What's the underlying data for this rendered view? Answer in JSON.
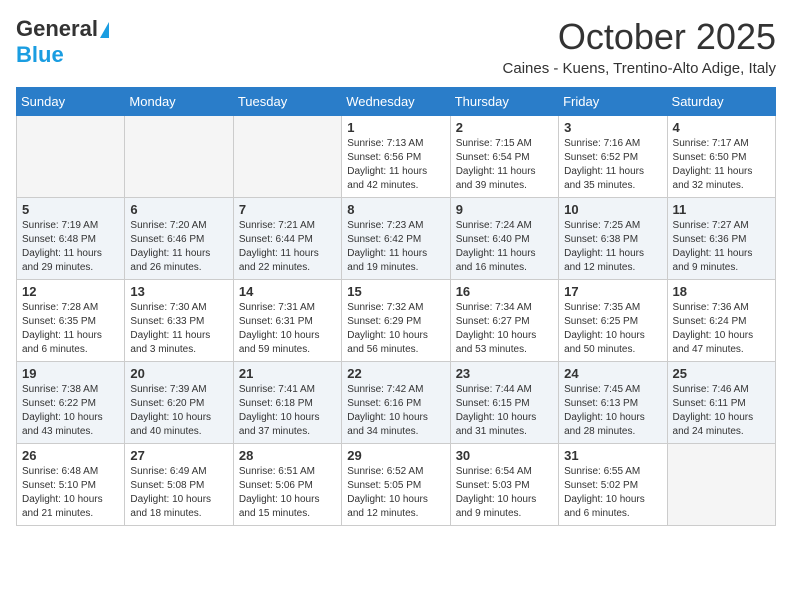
{
  "header": {
    "logo_general": "General",
    "logo_blue": "Blue",
    "month_title": "October 2025",
    "subtitle": "Caines - Kuens, Trentino-Alto Adige, Italy"
  },
  "weekdays": [
    "Sunday",
    "Monday",
    "Tuesday",
    "Wednesday",
    "Thursday",
    "Friday",
    "Saturday"
  ],
  "weeks": [
    [
      {
        "day": "",
        "sunrise": "",
        "sunset": "",
        "daylight": ""
      },
      {
        "day": "",
        "sunrise": "",
        "sunset": "",
        "daylight": ""
      },
      {
        "day": "",
        "sunrise": "",
        "sunset": "",
        "daylight": ""
      },
      {
        "day": "1",
        "sunrise": "Sunrise: 7:13 AM",
        "sunset": "Sunset: 6:56 PM",
        "daylight": "Daylight: 11 hours and 42 minutes."
      },
      {
        "day": "2",
        "sunrise": "Sunrise: 7:15 AM",
        "sunset": "Sunset: 6:54 PM",
        "daylight": "Daylight: 11 hours and 39 minutes."
      },
      {
        "day": "3",
        "sunrise": "Sunrise: 7:16 AM",
        "sunset": "Sunset: 6:52 PM",
        "daylight": "Daylight: 11 hours and 35 minutes."
      },
      {
        "day": "4",
        "sunrise": "Sunrise: 7:17 AM",
        "sunset": "Sunset: 6:50 PM",
        "daylight": "Daylight: 11 hours and 32 minutes."
      }
    ],
    [
      {
        "day": "5",
        "sunrise": "Sunrise: 7:19 AM",
        "sunset": "Sunset: 6:48 PM",
        "daylight": "Daylight: 11 hours and 29 minutes."
      },
      {
        "day": "6",
        "sunrise": "Sunrise: 7:20 AM",
        "sunset": "Sunset: 6:46 PM",
        "daylight": "Daylight: 11 hours and 26 minutes."
      },
      {
        "day": "7",
        "sunrise": "Sunrise: 7:21 AM",
        "sunset": "Sunset: 6:44 PM",
        "daylight": "Daylight: 11 hours and 22 minutes."
      },
      {
        "day": "8",
        "sunrise": "Sunrise: 7:23 AM",
        "sunset": "Sunset: 6:42 PM",
        "daylight": "Daylight: 11 hours and 19 minutes."
      },
      {
        "day": "9",
        "sunrise": "Sunrise: 7:24 AM",
        "sunset": "Sunset: 6:40 PM",
        "daylight": "Daylight: 11 hours and 16 minutes."
      },
      {
        "day": "10",
        "sunrise": "Sunrise: 7:25 AM",
        "sunset": "Sunset: 6:38 PM",
        "daylight": "Daylight: 11 hours and 12 minutes."
      },
      {
        "day": "11",
        "sunrise": "Sunrise: 7:27 AM",
        "sunset": "Sunset: 6:36 PM",
        "daylight": "Daylight: 11 hours and 9 minutes."
      }
    ],
    [
      {
        "day": "12",
        "sunrise": "Sunrise: 7:28 AM",
        "sunset": "Sunset: 6:35 PM",
        "daylight": "Daylight: 11 hours and 6 minutes."
      },
      {
        "day": "13",
        "sunrise": "Sunrise: 7:30 AM",
        "sunset": "Sunset: 6:33 PM",
        "daylight": "Daylight: 11 hours and 3 minutes."
      },
      {
        "day": "14",
        "sunrise": "Sunrise: 7:31 AM",
        "sunset": "Sunset: 6:31 PM",
        "daylight": "Daylight: 10 hours and 59 minutes."
      },
      {
        "day": "15",
        "sunrise": "Sunrise: 7:32 AM",
        "sunset": "Sunset: 6:29 PM",
        "daylight": "Daylight: 10 hours and 56 minutes."
      },
      {
        "day": "16",
        "sunrise": "Sunrise: 7:34 AM",
        "sunset": "Sunset: 6:27 PM",
        "daylight": "Daylight: 10 hours and 53 minutes."
      },
      {
        "day": "17",
        "sunrise": "Sunrise: 7:35 AM",
        "sunset": "Sunset: 6:25 PM",
        "daylight": "Daylight: 10 hours and 50 minutes."
      },
      {
        "day": "18",
        "sunrise": "Sunrise: 7:36 AM",
        "sunset": "Sunset: 6:24 PM",
        "daylight": "Daylight: 10 hours and 47 minutes."
      }
    ],
    [
      {
        "day": "19",
        "sunrise": "Sunrise: 7:38 AM",
        "sunset": "Sunset: 6:22 PM",
        "daylight": "Daylight: 10 hours and 43 minutes."
      },
      {
        "day": "20",
        "sunrise": "Sunrise: 7:39 AM",
        "sunset": "Sunset: 6:20 PM",
        "daylight": "Daylight: 10 hours and 40 minutes."
      },
      {
        "day": "21",
        "sunrise": "Sunrise: 7:41 AM",
        "sunset": "Sunset: 6:18 PM",
        "daylight": "Daylight: 10 hours and 37 minutes."
      },
      {
        "day": "22",
        "sunrise": "Sunrise: 7:42 AM",
        "sunset": "Sunset: 6:16 PM",
        "daylight": "Daylight: 10 hours and 34 minutes."
      },
      {
        "day": "23",
        "sunrise": "Sunrise: 7:44 AM",
        "sunset": "Sunset: 6:15 PM",
        "daylight": "Daylight: 10 hours and 31 minutes."
      },
      {
        "day": "24",
        "sunrise": "Sunrise: 7:45 AM",
        "sunset": "Sunset: 6:13 PM",
        "daylight": "Daylight: 10 hours and 28 minutes."
      },
      {
        "day": "25",
        "sunrise": "Sunrise: 7:46 AM",
        "sunset": "Sunset: 6:11 PM",
        "daylight": "Daylight: 10 hours and 24 minutes."
      }
    ],
    [
      {
        "day": "26",
        "sunrise": "Sunrise: 6:48 AM",
        "sunset": "Sunset: 5:10 PM",
        "daylight": "Daylight: 10 hours and 21 minutes."
      },
      {
        "day": "27",
        "sunrise": "Sunrise: 6:49 AM",
        "sunset": "Sunset: 5:08 PM",
        "daylight": "Daylight: 10 hours and 18 minutes."
      },
      {
        "day": "28",
        "sunrise": "Sunrise: 6:51 AM",
        "sunset": "Sunset: 5:06 PM",
        "daylight": "Daylight: 10 hours and 15 minutes."
      },
      {
        "day": "29",
        "sunrise": "Sunrise: 6:52 AM",
        "sunset": "Sunset: 5:05 PM",
        "daylight": "Daylight: 10 hours and 12 minutes."
      },
      {
        "day": "30",
        "sunrise": "Sunrise: 6:54 AM",
        "sunset": "Sunset: 5:03 PM",
        "daylight": "Daylight: 10 hours and 9 minutes."
      },
      {
        "day": "31",
        "sunrise": "Sunrise: 6:55 AM",
        "sunset": "Sunset: 5:02 PM",
        "daylight": "Daylight: 10 hours and 6 minutes."
      },
      {
        "day": "",
        "sunrise": "",
        "sunset": "",
        "daylight": ""
      }
    ]
  ]
}
